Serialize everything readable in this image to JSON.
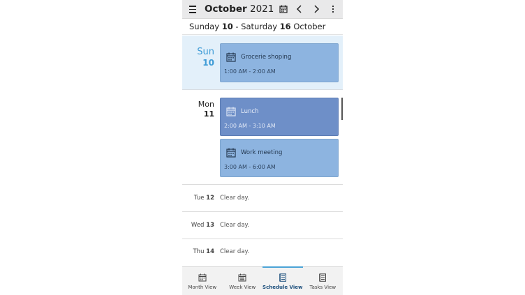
{
  "header": {
    "month": "October",
    "year": "2021",
    "calendar_icon": "calendar-icon",
    "prev_icon": "chevron-left-icon",
    "next_icon": "chevron-right-icon",
    "more_icon": "more-vertical-icon"
  },
  "range": {
    "start_day": "Sunday",
    "start_num": "10",
    "separator": " - ",
    "end_day": "Saturday",
    "end_num": "16",
    "end_month": "October"
  },
  "days": [
    {
      "name": "Sun",
      "num": "10",
      "highlighted": true,
      "events": [
        {
          "title": "Grocerie shoping",
          "time": "1:00 AM - 2:00 AM",
          "color": "#8db4e0"
        }
      ]
    },
    {
      "name": "Mon",
      "num": "11",
      "events": [
        {
          "title": "Lunch",
          "time": "2:00 AM - 3:10 AM",
          "color": "#6e8fc8"
        },
        {
          "title": "Work meeting",
          "time": "3:00 AM - 6:00 AM",
          "color": "#8db4e0"
        }
      ]
    }
  ],
  "clear_days": [
    {
      "name": "Tue",
      "num": "12",
      "text": "Clear day."
    },
    {
      "name": "Wed",
      "num": "13",
      "text": "Clear day."
    },
    {
      "name": "Thu",
      "num": "14",
      "text": "Clear day."
    }
  ],
  "tabs": [
    {
      "label": "Month View",
      "active": false
    },
    {
      "label": "Week View",
      "active": false
    },
    {
      "label": "Schedule View",
      "active": true
    },
    {
      "label": "Tasks View",
      "active": false
    }
  ],
  "colors": {
    "accent": "#4aa3d6",
    "today_bg": "#e3f0fa",
    "today_text": "#3d9bd6"
  }
}
